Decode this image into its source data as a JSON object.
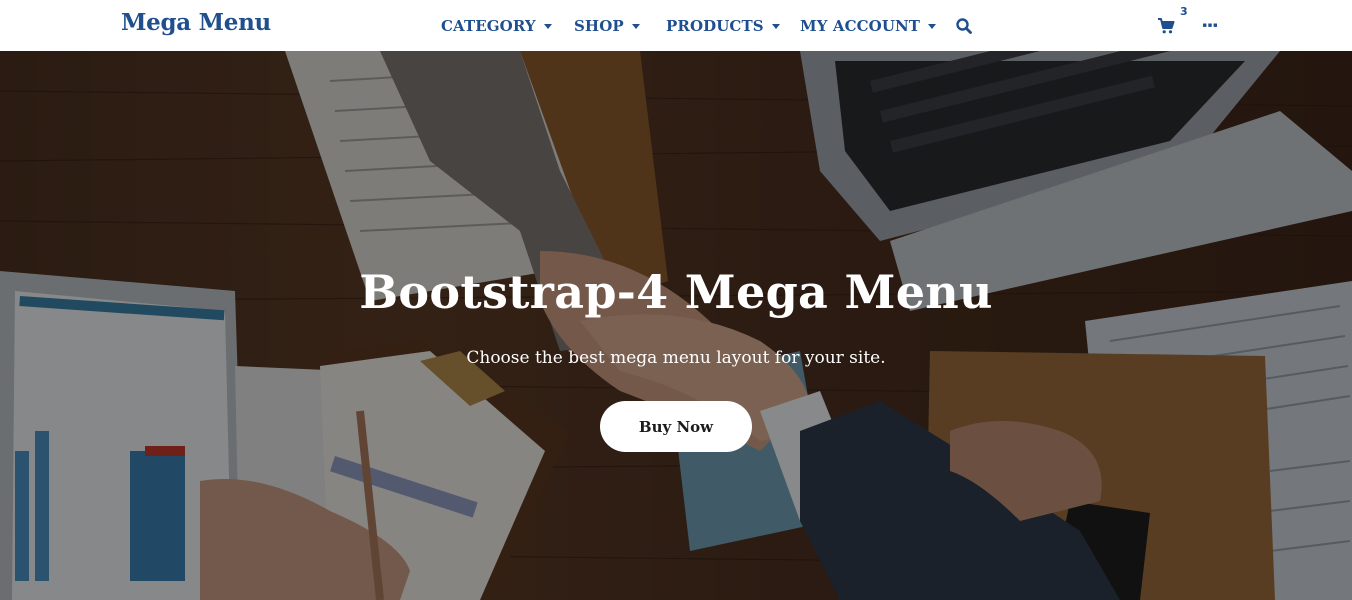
{
  "brand": {
    "name": "Mega Menu"
  },
  "nav": {
    "items": [
      {
        "label": "CATEGORY"
      },
      {
        "label": "SHOP"
      },
      {
        "label": "PRODUCTS"
      },
      {
        "label": "MY ACCOUNT"
      }
    ],
    "search_icon": "search-icon",
    "cart_icon": "shopping-cart-icon",
    "cart_count": "3",
    "more_icon": "ellipsis-icon"
  },
  "hero": {
    "title": "Bootstrap-4 Mega Menu",
    "subtitle": "Choose the best mega menu layout for your site.",
    "cta_label": "Buy Now"
  },
  "colors": {
    "brand": "#1f4f8e",
    "navbar_bg": "#ffffff",
    "hero_text": "#ffffff",
    "button_bg": "#ffffff"
  }
}
